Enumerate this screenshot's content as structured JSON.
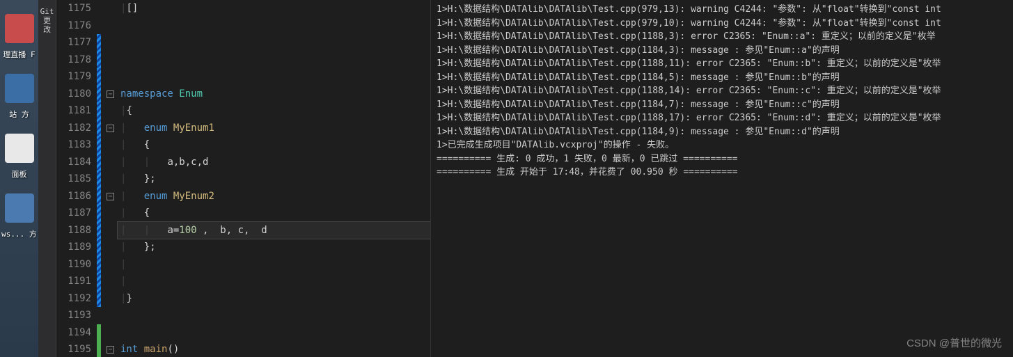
{
  "desktop": {
    "labels": [
      "理直播  F",
      "站    方",
      "面板",
      "ws...  方"
    ]
  },
  "sidebar": {
    "items": [
      "Git 更改"
    ]
  },
  "gutter": {
    "start": 1175,
    "end": 1195
  },
  "code": {
    "lines": [
      {
        "n": 1175,
        "cm": "",
        "fold": "",
        "tokens": [
          {
            "c": "guide",
            "t": "|"
          },
          {
            "c": "punct",
            "t": "[]"
          }
        ]
      },
      {
        "n": 1176,
        "cm": "",
        "fold": "",
        "tokens": []
      },
      {
        "n": 1177,
        "cm": "cm-blue",
        "fold": "",
        "tokens": []
      },
      {
        "n": 1178,
        "cm": "cm-blue",
        "fold": "",
        "tokens": []
      },
      {
        "n": 1179,
        "cm": "cm-blue",
        "fold": "",
        "tokens": []
      },
      {
        "n": 1180,
        "cm": "cm-blue",
        "fold": "-",
        "tokens": [
          {
            "c": "kw",
            "t": "namespace "
          },
          {
            "c": "type",
            "t": "Enum"
          }
        ]
      },
      {
        "n": 1181,
        "cm": "cm-blue",
        "fold": "",
        "tokens": [
          {
            "c": "guide",
            "t": "|"
          },
          {
            "c": "punct",
            "t": "{"
          }
        ]
      },
      {
        "n": 1182,
        "cm": "cm-blue",
        "fold": "-",
        "tokens": [
          {
            "c": "guide",
            "t": "|   "
          },
          {
            "c": "kw",
            "t": "enum "
          },
          {
            "c": "ident",
            "t": "MyEnum1"
          }
        ]
      },
      {
        "n": 1183,
        "cm": "cm-blue",
        "fold": "",
        "tokens": [
          {
            "c": "guide",
            "t": "|   "
          },
          {
            "c": "punct",
            "t": "{"
          }
        ]
      },
      {
        "n": 1184,
        "cm": "cm-blue",
        "fold": "",
        "tokens": [
          {
            "c": "guide",
            "t": "|   |   "
          },
          {
            "c": "punct",
            "t": "a,b,c,d"
          }
        ]
      },
      {
        "n": 1185,
        "cm": "cm-blue",
        "fold": "",
        "tokens": [
          {
            "c": "guide",
            "t": "|   "
          },
          {
            "c": "punct",
            "t": "};"
          }
        ]
      },
      {
        "n": 1186,
        "cm": "cm-blue",
        "fold": "-",
        "tokens": [
          {
            "c": "guide",
            "t": "|   "
          },
          {
            "c": "kw",
            "t": "enum "
          },
          {
            "c": "ident",
            "t": "MyEnum2"
          }
        ]
      },
      {
        "n": 1187,
        "cm": "cm-blue",
        "fold": "",
        "tokens": [
          {
            "c": "guide",
            "t": "|   "
          },
          {
            "c": "punct",
            "t": "{"
          }
        ]
      },
      {
        "n": 1188,
        "cm": "cm-blue",
        "fold": "",
        "cur": true,
        "tokens": [
          {
            "c": "guide",
            "t": "|   |   "
          },
          {
            "c": "punct",
            "t": "a="
          },
          {
            "c": "num",
            "t": "100"
          },
          {
            "c": "punct",
            "t": " ,  b, c,  d"
          }
        ]
      },
      {
        "n": 1189,
        "cm": "cm-blue",
        "fold": "",
        "tokens": [
          {
            "c": "guide",
            "t": "|   "
          },
          {
            "c": "punct",
            "t": "};"
          }
        ]
      },
      {
        "n": 1190,
        "cm": "cm-blue",
        "fold": "",
        "tokens": [
          {
            "c": "guide",
            "t": "|"
          }
        ]
      },
      {
        "n": 1191,
        "cm": "cm-blue",
        "fold": "",
        "tokens": [
          {
            "c": "guide",
            "t": "|"
          }
        ]
      },
      {
        "n": 1192,
        "cm": "cm-blue",
        "fold": "",
        "tokens": [
          {
            "c": "guide",
            "t": "|"
          },
          {
            "c": "punct",
            "t": "}"
          }
        ]
      },
      {
        "n": 1193,
        "cm": "",
        "fold": "",
        "tokens": []
      },
      {
        "n": 1194,
        "cm": "cm-green",
        "fold": "",
        "tokens": []
      },
      {
        "n": 1195,
        "cm": "cm-green",
        "fold": "-",
        "tokens": [
          {
            "c": "kw",
            "t": "int "
          },
          {
            "c": "ident2",
            "t": "main"
          },
          {
            "c": "punct",
            "t": "()"
          }
        ]
      }
    ]
  },
  "output": {
    "lines": [
      "1>H:\\数据结构\\DATAlib\\DATAlib\\Test.cpp(979,13): warning C4244: \"参数\": 从\"float\"转换到\"const int",
      "1>H:\\数据结构\\DATAlib\\DATAlib\\Test.cpp(979,10): warning C4244: \"参数\": 从\"float\"转换到\"const int",
      "1>H:\\数据结构\\DATAlib\\DATAlib\\Test.cpp(1188,3): error C2365: \"Enum::a\": 重定义；以前的定义是\"枚举",
      "1>H:\\数据结构\\DATAlib\\DATAlib\\Test.cpp(1184,3): message : 参见\"Enum::a\"的声明",
      "1>H:\\数据结构\\DATAlib\\DATAlib\\Test.cpp(1188,11): error C2365: \"Enum::b\": 重定义；以前的定义是\"枚举",
      "1>H:\\数据结构\\DATAlib\\DATAlib\\Test.cpp(1184,5): message : 参见\"Enum::b\"的声明",
      "1>H:\\数据结构\\DATAlib\\DATAlib\\Test.cpp(1188,14): error C2365: \"Enum::c\": 重定义；以前的定义是\"枚举",
      "1>H:\\数据结构\\DATAlib\\DATAlib\\Test.cpp(1184,7): message : 参见\"Enum::c\"的声明",
      "1>H:\\数据结构\\DATAlib\\DATAlib\\Test.cpp(1188,17): error C2365: \"Enum::d\": 重定义；以前的定义是\"枚举",
      "1>H:\\数据结构\\DATAlib\\DATAlib\\Test.cpp(1184,9): message : 参见\"Enum::d\"的声明",
      "1>已完成生成项目\"DATAlib.vcxproj\"的操作 - 失败。",
      "========== 生成: 0 成功，1 失败，0 最新，0 已跳过 ==========",
      "========== 生成 开始于 17:48，并花费了 00.950 秒 =========="
    ]
  },
  "watermark": "CSDN @普世的微光"
}
